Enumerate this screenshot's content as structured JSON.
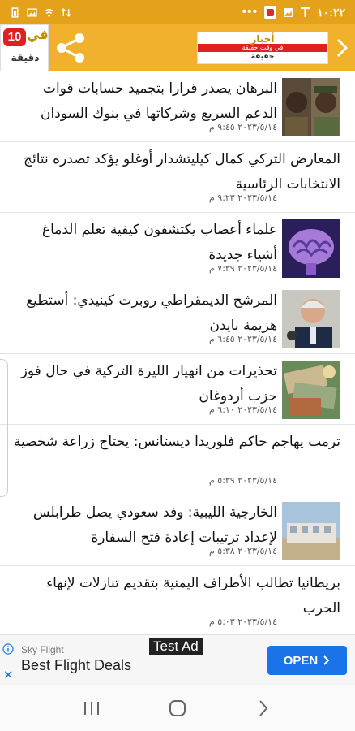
{
  "status_bar": {
    "time": "١٠:٢٢",
    "overflow": "•••"
  },
  "header": {
    "left_logo": {
      "number": "10",
      "word": "في",
      "sub": "دقيقة"
    },
    "banner": {
      "line1": "أخبار",
      "line2": "في وقت حقيقة",
      "line3": "حقيقة"
    },
    "icons": [
      "share-icon",
      "chevron-right-icon"
    ],
    "accent": "#f2b12d",
    "status_color": "#e3a21a"
  },
  "feed": {
    "items": [
      {
        "title": "البرهان يصدر قرارا بتجميد حسابات قوات الدعم السريع وشركاتها في بنوك السودان",
        "date": "٢٠٢٣/٥/١٤ ٩:٤٥ م",
        "image": "two-officials"
      },
      {
        "title": "المعارض التركي كمال كيليتشدار أوغلو يؤكد تصدره نتائج الانتخابات الرئاسية",
        "date": "٢٠٢٣/٥/١٤ ٩:٢٣ م",
        "image": ""
      },
      {
        "title": "علماء أعصاب يكتشفون كيفية تعلم الدماغ أشياء جديدة",
        "date": "٢٠٢٣/٥/١٤ ٧:٣٩ م",
        "image": "brain"
      },
      {
        "title": "المرشح الديمقراطي روبرت كينيدي: أستطيع هزيمة بايدن",
        "date": "٢٠٢٣/٥/١٤ ٦:٤٥ م",
        "image": "speaker"
      },
      {
        "title": "تحذيرات من انهيار الليرة التركية في حال فوز حزب أردوغان",
        "date": "٢٠٢٣/٥/١٤ ٦:١٠ م",
        "image": "lira-notes"
      },
      {
        "title": "ترمب يهاجم حاكم فلوريدا ديستانس: يحتاج زراعة شخصية",
        "date": "٢٠٢٣/٥/١٤ ٥:٣٩ م",
        "image": ""
      },
      {
        "title": "الخارجية الليبية: وفد سعودي يصل طرابلس لإعداد ترتيبات إعادة فتح السفارة",
        "date": "٢٠٢٣/٥/١٤ ٥:٣٨ م",
        "image": "building"
      },
      {
        "title": "بريطانيا تطالب الأطراف اليمنية بتقديم تنازلات لإنهاء الحرب",
        "date": "٢٠٢٣/٥/١٤ ٥:٠٣ م",
        "image": ""
      }
    ]
  },
  "ad": {
    "label": "Test Ad",
    "advertiser": "Sky Flight",
    "title": "Best Flight Deals",
    "cta": "OPEN",
    "close": "✕",
    "cta_color": "#1a73e8"
  },
  "nav": {
    "icons": [
      "recents-icon",
      "home-icon",
      "back-icon"
    ]
  }
}
